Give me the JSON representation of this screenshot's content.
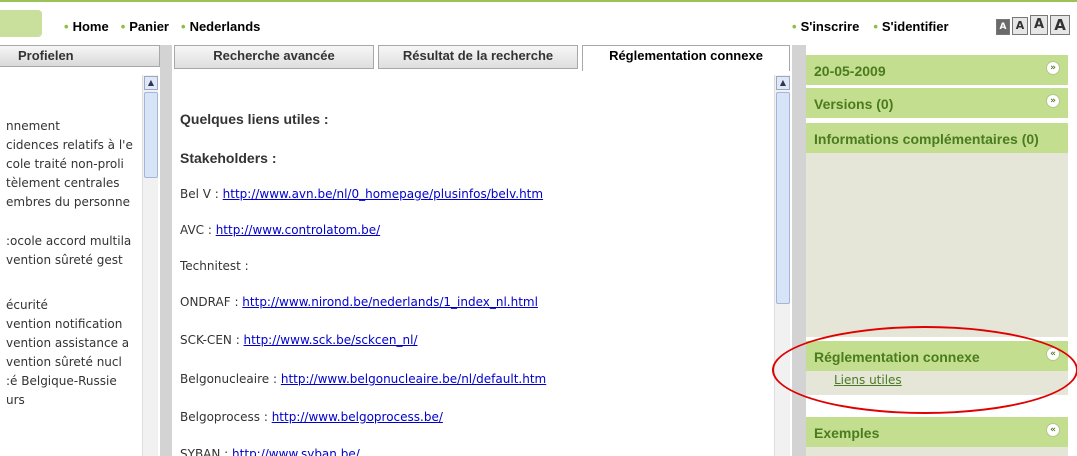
{
  "topnav": {
    "links": [
      {
        "label": "Home"
      },
      {
        "label": "Panier"
      },
      {
        "label": "Nederlands"
      }
    ],
    "account_links": [
      {
        "label": "S'inscrire"
      },
      {
        "label": "S'identifier"
      }
    ],
    "font_sizes": [
      "A",
      "A",
      "A",
      "A"
    ]
  },
  "left_panel": {
    "tab_label": "Profielen",
    "items": [
      "nnement",
      "cidences relatifs à l'e",
      "cole traité non-proli",
      "tèlement centrales",
      "embres du personne",
      ":ocole accord multila",
      "vention sûreté gest",
      "écurité",
      "vention notification",
      "vention assistance a",
      "vention sûreté nucl",
      ":é Belgique-Russie",
      "urs"
    ]
  },
  "main": {
    "tabs": [
      {
        "label": "Recherche avancée"
      },
      {
        "label": "Résultat de la recherche"
      },
      {
        "label": "Réglementation connexe"
      }
    ],
    "content": {
      "heading1": "Quelques liens utiles :",
      "heading2": "Stakeholders :",
      "lines": [
        {
          "label": "Bel V : ",
          "link": "http://www.avn.be/nl/0_homepage/plusinfos/belv.htm"
        },
        {
          "label": "AVC : ",
          "link": "http://www.controlatom.be/"
        },
        {
          "label": "Technitest :",
          "link": ""
        },
        {
          "label": "ONDRAF : ",
          "link": "http://www.nirond.be/nederlands/1_index_nl.html"
        },
        {
          "label": "SCK-CEN : ",
          "link": "http://www.sck.be/sckcen_nl/"
        },
        {
          "label": "Belgonucleaire : ",
          "link": "http://www.belgonucleaire.be/nl/default.htm"
        },
        {
          "label": "Belgoprocess : ",
          "link": "http://www.belgoprocess.be/"
        },
        {
          "label": "SYBAN : ",
          "link": "http://www.syban.be/"
        }
      ]
    }
  },
  "right_panel": {
    "date_box": {
      "title": "20-05-2009"
    },
    "versions_box": {
      "title": "Versions (0)"
    },
    "info_box": {
      "title": "Informations complémentaires (0)"
    },
    "reglementation_box": {
      "title": "Réglementation connexe",
      "link": "Liens utiles"
    },
    "exemples_box": {
      "title": "Exemples"
    }
  },
  "colors": {
    "accent_green": "#c3de8e",
    "title_green": "#4a7c1f",
    "link_blue": "#0000cc",
    "annotation_red": "#e00000"
  },
  "icons": {
    "collapse": "chevron-down-double-icon",
    "expand": "chevron-up-double-icon"
  }
}
